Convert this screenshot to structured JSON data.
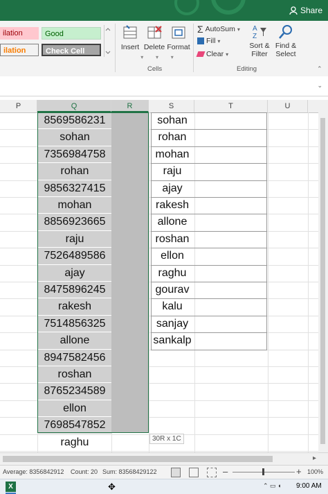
{
  "ribbon": {
    "share_label": "Share",
    "styles": {
      "bad_partial": "ilation",
      "good": "Good",
      "check_cell": "Check Cell"
    },
    "cells_group": {
      "label": "Cells",
      "insert": "Insert",
      "delete": "Delete",
      "format": "Format"
    },
    "editing_group": {
      "label": "Editing",
      "autosum": "AutoSum",
      "fill": "Fill",
      "clear": "Clear",
      "sort_filter_1": "Sort &",
      "sort_filter_2": "Filter",
      "find_select_1": "Find &",
      "find_select_2": "Select"
    }
  },
  "columns": [
    "P",
    "Q",
    "R",
    "S",
    "T",
    "U"
  ],
  "column_q_values": [
    "8569586231",
    "sohan",
    "7356984758",
    "rohan",
    "9856327415",
    "mohan",
    "8856923665",
    "raju",
    "7526489586",
    "ajay",
    "8475896245",
    "rakesh",
    "7514856325",
    "allone",
    "8947582456",
    "roshan",
    "8765234589",
    "ellon",
    "7698547852",
    "raghu"
  ],
  "column_s_values": [
    "sohan",
    "rohan",
    "mohan",
    "raju",
    "ajay",
    "rakesh",
    "allone",
    "roshan",
    "ellon",
    "raghu",
    "gourav",
    "kalu",
    "sanjay",
    "sankalp"
  ],
  "selection_tooltip": "30R x 1C",
  "status_bar": {
    "average": "Average: 8356842912",
    "count": "Count: 20",
    "sum": "Sum: 83568429122",
    "zoom": "100%"
  },
  "taskbar": {
    "time": "9:00 AM",
    "app_icon_label": "X"
  },
  "colors": {
    "accent": "#217346",
    "title_bar": "#1e7145"
  }
}
